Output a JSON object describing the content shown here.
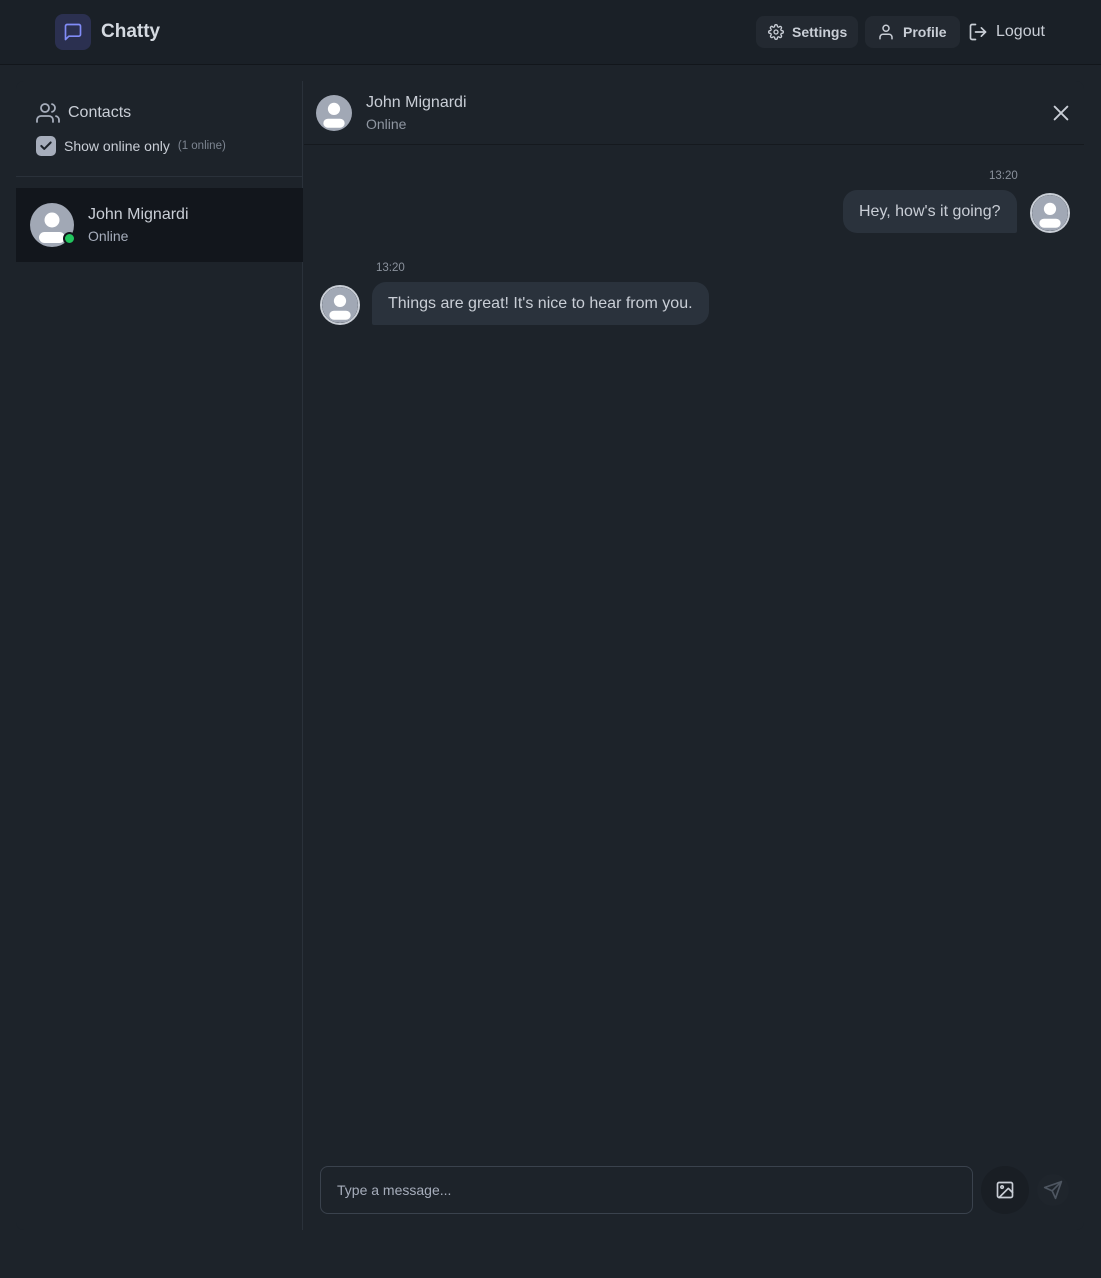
{
  "app": {
    "name": "Chatty"
  },
  "nav": {
    "settings_label": "Settings",
    "profile_label": "Profile",
    "logout_label": "Logout"
  },
  "sidebar": {
    "title": "Contacts",
    "filter_label": "Show online only",
    "filter_checked": true,
    "online_count": "(1 online)",
    "contacts": [
      {
        "name": "John Mignardi",
        "status": "Online",
        "online": true,
        "selected": true
      }
    ]
  },
  "chat": {
    "contact_name": "John Mignardi",
    "contact_status": "Online",
    "messages": [
      {
        "direction": "outgoing",
        "time": "13:20",
        "text": "Hey, how's it going?"
      },
      {
        "direction": "incoming",
        "time": "13:20",
        "text": "Things are great! It's nice to hear from you."
      }
    ],
    "composer": {
      "placeholder": "Type a message..."
    }
  },
  "colors": {
    "background": "#1d232a",
    "navbar": "#1a2027",
    "bubble": "#2a323c",
    "online_dot": "#22c55e",
    "brand_icon": "#818cf8"
  },
  "icons": {
    "brand": "message-square-icon",
    "settings": "gear-icon",
    "profile": "user-icon",
    "logout": "logout-icon",
    "contacts": "users-icon",
    "close": "close-icon",
    "image": "image-icon",
    "send": "send-icon"
  }
}
